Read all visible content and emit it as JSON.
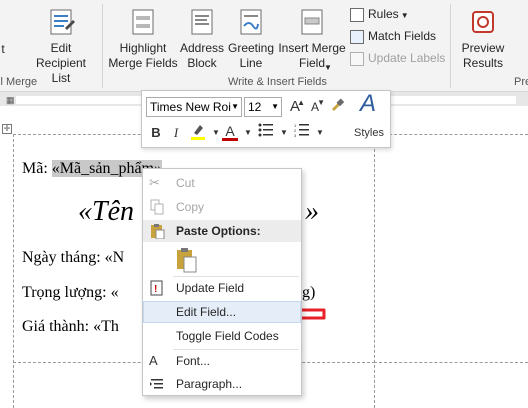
{
  "ribbon": {
    "left_partial_label": "t",
    "edit_recipient_label": "Edit\nRecipient List",
    "mail_merge_group_partial": "il Merge",
    "highlight_label": "Highlight\nMerge Fields",
    "address_block_label": "Address\nBlock",
    "greeting_line_label": "Greeting\nLine",
    "insert_merge_field_label": "Insert Merge\nField",
    "rules_label": "Rules",
    "match_fields_label": "Match Fields",
    "update_labels_label": "Update Labels",
    "group_write_insert": "Write & Insert Fields",
    "preview_results_label": "Preview\nResults",
    "right_partial_group": "Pre"
  },
  "mini_toolbar": {
    "font_name": "Times New Roi",
    "font_size": "12",
    "styles_label": "Styles",
    "bold": "B",
    "italic": "I",
    "font_color_glyph": "A",
    "grow_font": "A",
    "shrink_font": "A",
    "styles_glyph": "A"
  },
  "document": {
    "line1_label": "Mã: ",
    "line1_field": "«Mã_sản_phẩm»",
    "title_field": "«Tên",
    "title_tail": "»",
    "line3": "Ngày tháng: «N",
    "line4": "Trọng lượng: «",
    "line4_tail": "g)",
    "line5": "Giá thành: «Th"
  },
  "context_menu": {
    "cut": "Cut",
    "copy": "Copy",
    "paste_options": "Paste Options:",
    "update_field": "Update Field",
    "edit_field": "Edit Field...",
    "toggle_field_codes": "Toggle Field Codes",
    "font": "Font...",
    "paragraph": "Paragraph..."
  },
  "colors": {
    "ribbon_bg": "#f3f3f3",
    "highlight_bg": "#c8c8c8",
    "arrow": "#e8202a",
    "menu_hover": "#e5eef8",
    "font_color_bar": "#c00000",
    "highlighter_bar": "#ffff00"
  }
}
